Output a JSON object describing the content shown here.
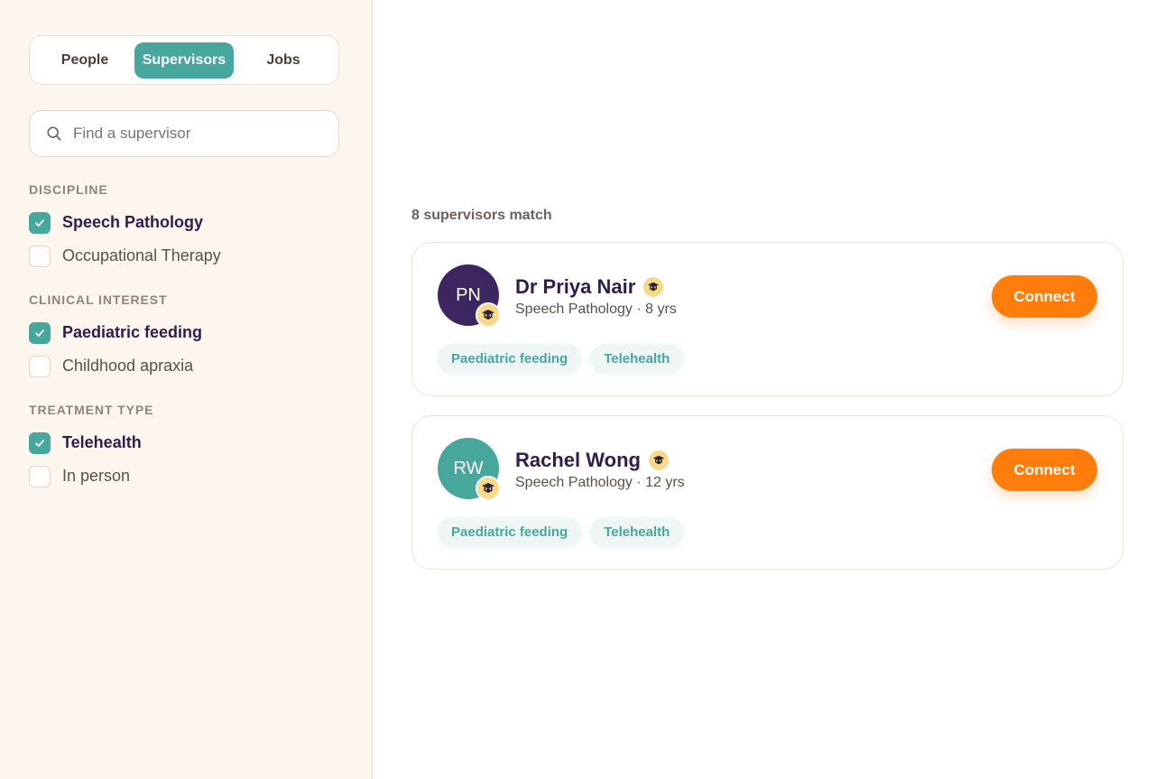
{
  "tabs": [
    {
      "label": "People",
      "active": false
    },
    {
      "label": "Supervisors",
      "active": true
    },
    {
      "label": "Jobs",
      "active": false
    }
  ],
  "search": {
    "placeholder": "Find a supervisor",
    "value": "",
    "icon": "search-icon"
  },
  "filters": [
    {
      "title": "DISCIPLINE",
      "options": [
        {
          "label": "Speech Pathology",
          "checked": true
        },
        {
          "label": "Occupational Therapy",
          "checked": false
        }
      ]
    },
    {
      "title": "CLINICAL INTEREST",
      "options": [
        {
          "label": "Paediatric feeding",
          "checked": true
        },
        {
          "label": "Childhood apraxia",
          "checked": false
        }
      ]
    },
    {
      "title": "TREATMENT TYPE",
      "options": [
        {
          "label": "Telehealth",
          "checked": true
        },
        {
          "label": "In person",
          "checked": false
        }
      ]
    }
  ],
  "results": {
    "count_text": "8 supervisors match",
    "cards": [
      {
        "initials": "PN",
        "avatar_color": "#3d2660",
        "name": "Dr Priya Nair",
        "meta": "Speech Pathology · 8 yrs",
        "connect_label": "Connect",
        "tags": [
          "Paediatric feeding",
          "Telehealth"
        ]
      },
      {
        "initials": "RW",
        "avatar_color": "#47a79c",
        "name": "Rachel Wong",
        "meta": "Speech Pathology · 12 yrs",
        "connect_label": "Connect",
        "tags": [
          "Paediatric feeding",
          "Telehealth"
        ]
      }
    ]
  },
  "colors": {
    "accent_teal": "#47a79c",
    "connect_orange": "#ff7d0c",
    "heading_purple": "#2f1d4d",
    "sidebar_bg": "#fdf6ef",
    "badge_gold": "#f6d98a"
  }
}
